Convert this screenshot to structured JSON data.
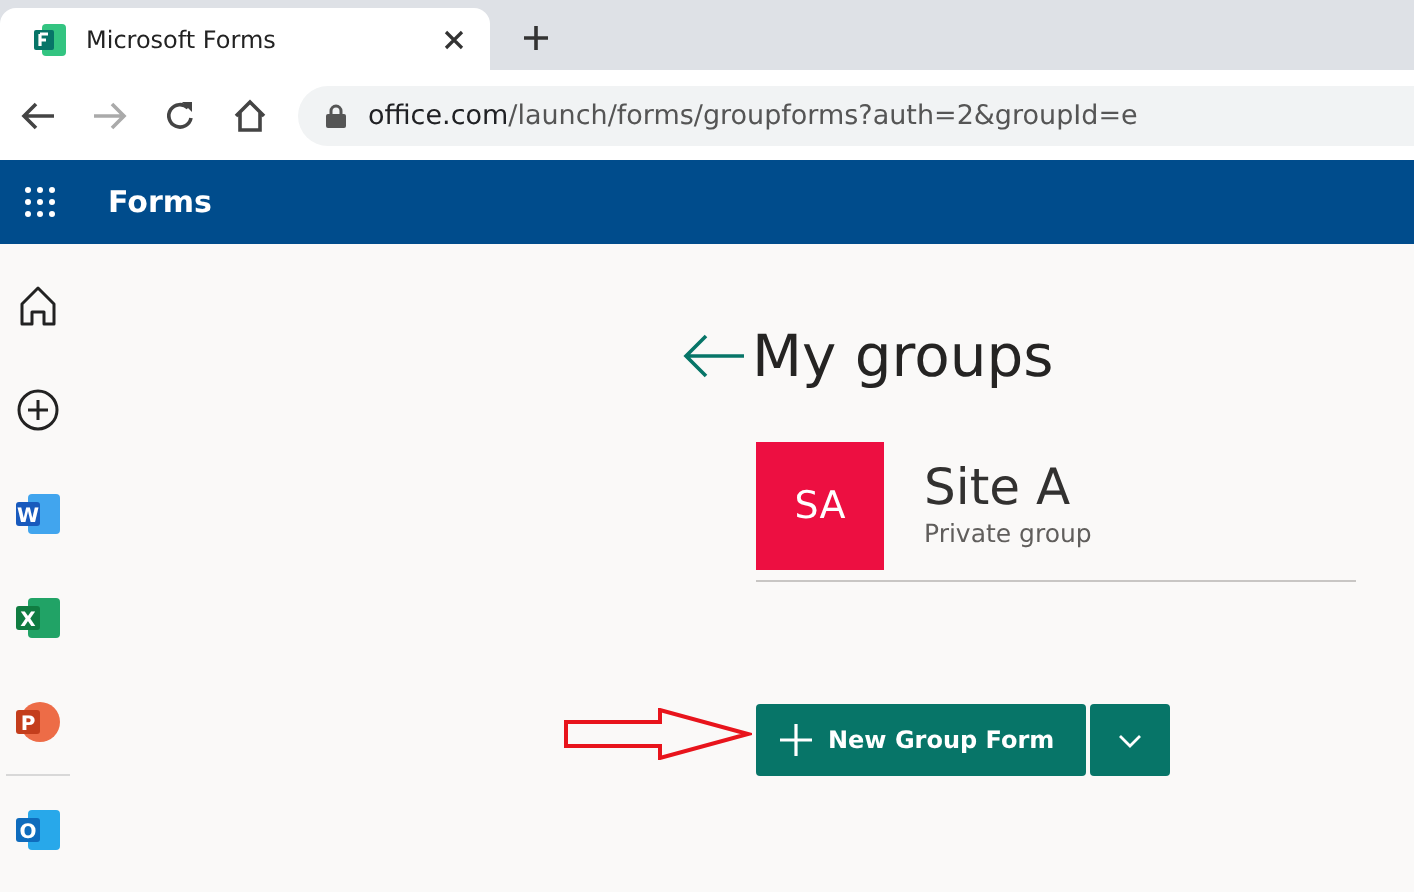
{
  "browser": {
    "tab_title": "Microsoft Forms",
    "url_host": "office.com",
    "url_path": "/launch/forms/groupforms?auth=2&groupId=e"
  },
  "header": {
    "app_name": "Forms"
  },
  "sidebar": {
    "items": [
      {
        "kind": "home"
      },
      {
        "kind": "add"
      },
      {
        "kind": "word",
        "letter": "W",
        "color": "#185abd"
      },
      {
        "kind": "excel",
        "letter": "X",
        "color": "#107c41"
      },
      {
        "kind": "powerpoint",
        "letter": "P",
        "color": "#c43e1c"
      },
      {
        "kind": "divider"
      },
      {
        "kind": "outlook",
        "letter": "O",
        "color": "#0f6cbd"
      }
    ]
  },
  "page": {
    "title": "My groups",
    "group": {
      "initials": "SA",
      "color": "#ed0f41",
      "name": "Site A",
      "subtitle": "Private group"
    },
    "new_button": "New Group Form"
  }
}
